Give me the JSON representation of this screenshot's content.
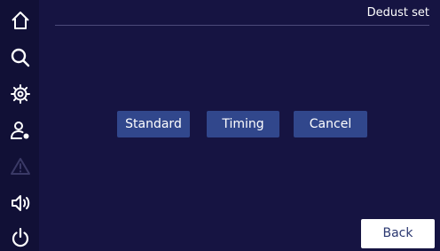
{
  "header": {
    "title": "Dedust set"
  },
  "sidebar": {
    "items": [
      {
        "icon": "home-icon",
        "enabled": true
      },
      {
        "icon": "search-icon",
        "enabled": true
      },
      {
        "icon": "gear-icon",
        "enabled": true
      },
      {
        "icon": "user-settings-icon",
        "enabled": true
      },
      {
        "icon": "warning-icon",
        "enabled": false
      },
      {
        "icon": "volume-icon",
        "enabled": true
      },
      {
        "icon": "power-icon",
        "enabled": true
      }
    ]
  },
  "main": {
    "buttons": [
      {
        "label": "Standard"
      },
      {
        "label": "Timing"
      },
      {
        "label": "Cancel"
      }
    ]
  },
  "footer": {
    "back_label": "Back"
  },
  "colors": {
    "background": "#161442",
    "sidebar": "#111036",
    "button": "#31478c",
    "icon": "#ffffff",
    "icon_disabled": "#3a3966",
    "back_button": "#ffffff",
    "back_text": "#2a3770"
  }
}
